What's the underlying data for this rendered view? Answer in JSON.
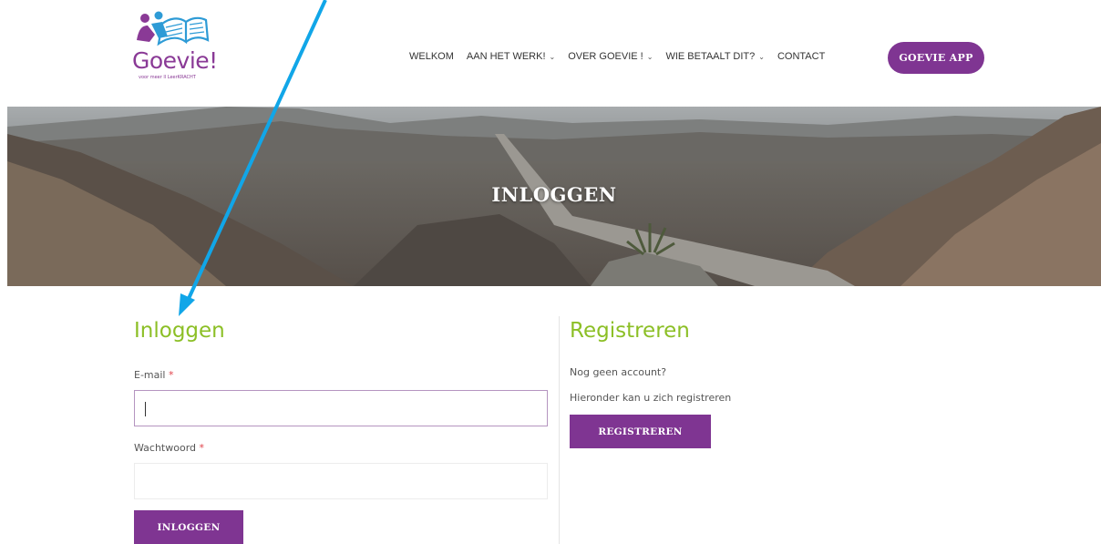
{
  "logo": {
    "word": "Goevie!",
    "tagline": "voor meer ll LeerKRACHT"
  },
  "nav": {
    "items": [
      {
        "label": "WELKOM",
        "dropdown": false
      },
      {
        "label": "AAN HET WERK!",
        "dropdown": true
      },
      {
        "label": "OVER GOEVIE !",
        "dropdown": true
      },
      {
        "label": "WIE BETAALT DIT?",
        "dropdown": true
      },
      {
        "label": "CONTACT",
        "dropdown": false
      }
    ],
    "app_button": "GOEVIE APP"
  },
  "hero": {
    "title": "INLOGGEN"
  },
  "login": {
    "title": "Inloggen",
    "email_label": "E-mail",
    "password_label": "Wachtwoord",
    "required_mark": "*",
    "email_value": "",
    "password_value": "",
    "submit_label": "INLOGGEN"
  },
  "register": {
    "title": "Registreren",
    "line1": "Nog geen account?",
    "line2": "Hieronder kan u zich registreren",
    "button_label": "REGISTREREN"
  },
  "colors": {
    "brand_purple": "#7f3592",
    "accent_green": "#8cbf26",
    "arrow_blue": "#11a6e8"
  }
}
